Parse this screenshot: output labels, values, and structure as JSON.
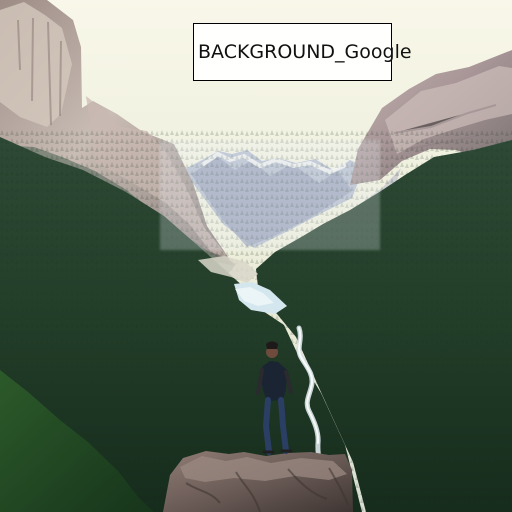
{
  "overlay": {
    "label": "BACKGROUND_Google"
  },
  "colors": {
    "sky": "#f2f2df",
    "rock": "#b8aaa1",
    "forest": "#233c26",
    "water": "#cfe2e8",
    "label_border": "#000000"
  },
  "icons": {
    "person": "person-icon",
    "waterfall": "waterfall-icon"
  }
}
